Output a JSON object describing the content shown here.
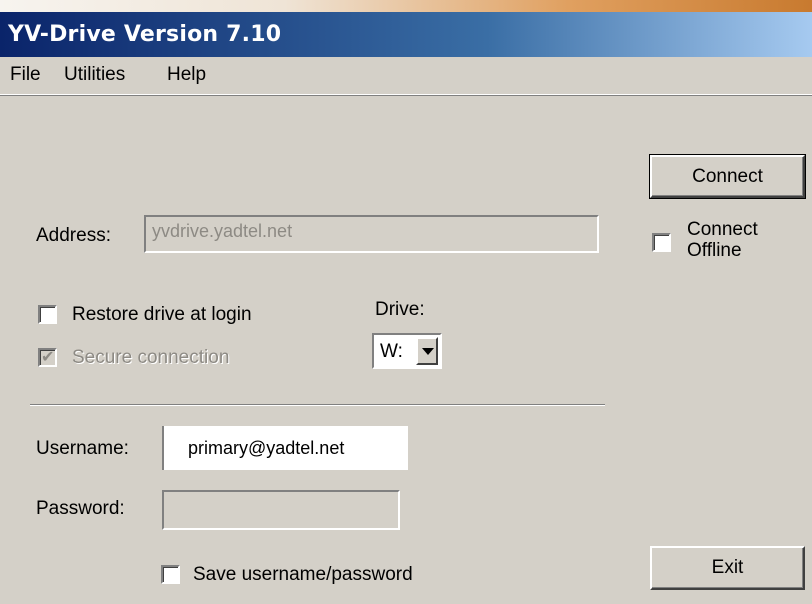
{
  "window": {
    "title": "YV-Drive Version 7.10"
  },
  "menu": {
    "items": [
      "File",
      "Utilities",
      "Help"
    ]
  },
  "buttons": {
    "connect": "Connect",
    "exit": "Exit"
  },
  "connect_offline": {
    "label_line1": "Connect",
    "label_line2": "Offline",
    "checked": false
  },
  "address": {
    "label": "Address:",
    "value": "yvdrive.yadtel.net",
    "disabled": true
  },
  "restore_drive": {
    "label": "Restore drive at login",
    "checked": false
  },
  "secure_connection": {
    "label": "Secure connection",
    "checked": true,
    "disabled": true
  },
  "drive": {
    "label": "Drive:",
    "selected": "W:"
  },
  "username": {
    "label": "Username:",
    "value": "primary@yadtel.net"
  },
  "password": {
    "label": "Password:",
    "value": ""
  },
  "save_credentials": {
    "label": "Save username/password",
    "checked": false
  },
  "icons": {
    "dropdown_arrow": "chevron-down-icon",
    "check": "check-icon"
  },
  "colors": {
    "title_start": "#0a246a",
    "title_end": "#a6caf0",
    "face": "#d4d0c8",
    "disabled_text": "#8d8a84"
  }
}
